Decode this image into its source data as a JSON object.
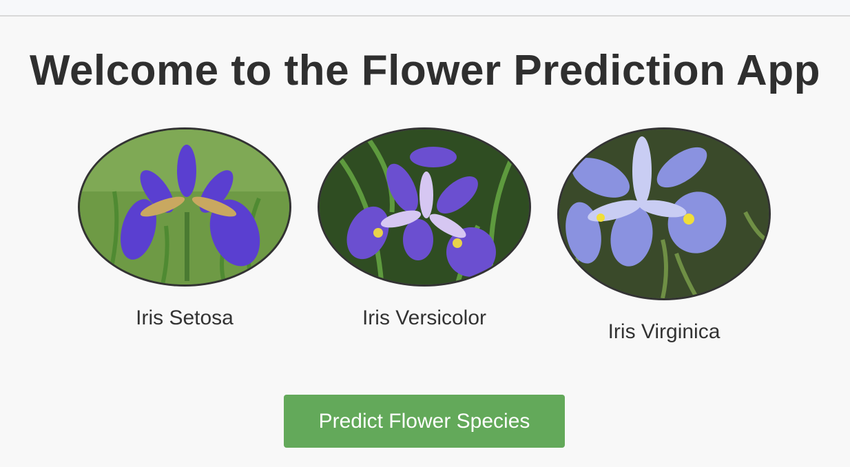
{
  "header": {
    "title": "Welcome to the Flower Prediction App"
  },
  "flowers": [
    {
      "label": "Iris Setosa",
      "image": "iris-setosa-photo"
    },
    {
      "label": "Iris Versicolor",
      "image": "iris-versicolor-photo"
    },
    {
      "label": "Iris Virginica",
      "image": "iris-virginica-photo"
    }
  ],
  "actions": {
    "predict_label": "Predict Flower Species"
  },
  "colors": {
    "button": "#63a95a",
    "title": "#2f2f2f",
    "background": "#f8f8f8",
    "setosa_petal": "#5a3fd0",
    "versicolor_petal": "#6b4fd0",
    "virginica_petal": "#8a92e0"
  }
}
